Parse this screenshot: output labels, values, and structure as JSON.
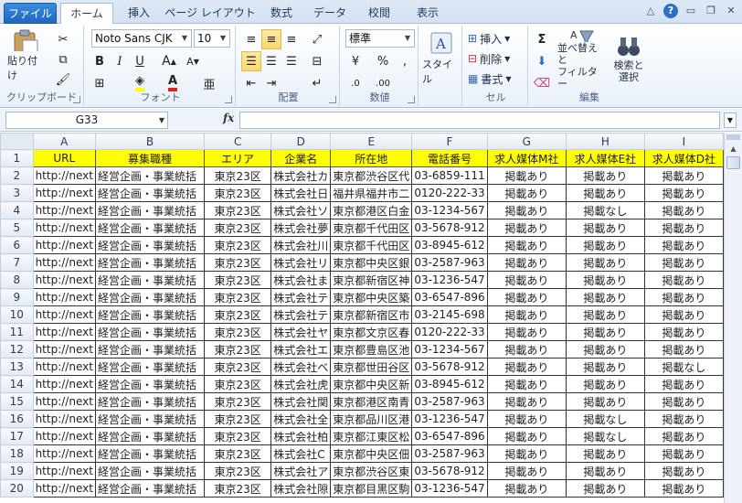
{
  "tabs": [
    "ファイル",
    "ホーム",
    "挿入",
    "ページ レイアウト",
    "数式",
    "データ",
    "校閲",
    "表示"
  ],
  "ribbon": {
    "clipboard": {
      "paste": "貼り付け",
      "label": "クリップボード"
    },
    "font": {
      "name": "Noto Sans CJK",
      "size": "10",
      "bold": "B",
      "italic": "I",
      "underline": "U",
      "label": "フォント"
    },
    "alignment": {
      "label": "配置"
    },
    "number": {
      "format": "標準",
      "label": "数値"
    },
    "styles": {
      "button": "スタイル"
    },
    "cells": {
      "insert": "挿入",
      "delete": "削除",
      "format": "書式",
      "label": "セル"
    },
    "editing": {
      "sum": "Σ",
      "sort": "並べ替えと\nフィルター",
      "sort_line1": "並べ替えと",
      "sort_line2": "フィルター",
      "find_line1": "検索と",
      "find_line2": "選択",
      "label": "編集"
    }
  },
  "formula_bar": {
    "name_box": "G33",
    "fx": "fx",
    "value": ""
  },
  "columns": [
    "A",
    "B",
    "C",
    "D",
    "E",
    "F",
    "G",
    "H",
    "I"
  ],
  "header_row": [
    "URL",
    "募集職種",
    "エリア",
    "企業名",
    "所在地",
    "電話番号",
    "求人媒体M社",
    "求人媒体E社",
    "求人媒体D社"
  ],
  "rows": [
    [
      "http://next",
      "経営企画・事業統括",
      "東京23区",
      "株式会社カ",
      "東京都渋谷区代",
      "03-6859-111",
      "掲載あり",
      "掲載あり",
      "掲載あり"
    ],
    [
      "http://next",
      "経営企画・事業統括",
      "東京23区",
      "株式会社日",
      "福井県福井市二",
      "0120-222-33",
      "掲載あり",
      "掲載あり",
      "掲載あり"
    ],
    [
      "http://next",
      "経営企画・事業統括",
      "東京23区",
      "株式会社ソ",
      "東京都港区白金",
      "03-1234-567",
      "掲載あり",
      "掲載なし",
      "掲載あり"
    ],
    [
      "http://next",
      "経営企画・事業統括",
      "東京23区",
      "株式会社夢",
      "東京都千代田区",
      "03-5678-912",
      "掲載あり",
      "掲載あり",
      "掲載あり"
    ],
    [
      "http://next",
      "経営企画・事業統括",
      "東京23区",
      "株式会社川",
      "東京都千代田区",
      "03-8945-612",
      "掲載あり",
      "掲載あり",
      "掲載あり"
    ],
    [
      "http://next",
      "経営企画・事業統括",
      "東京23区",
      "株式会社リ",
      "東京都中央区銀",
      "03-2587-963",
      "掲載あり",
      "掲載あり",
      "掲載あり"
    ],
    [
      "http://next",
      "経営企画・事業統括",
      "東京23区",
      "株式会社ま",
      "東京都新宿区神",
      "03-1236-547",
      "掲載あり",
      "掲載あり",
      "掲載あり"
    ],
    [
      "http://next",
      "経営企画・事業統括",
      "東京23区",
      "株式会社テ",
      "東京都中央区築",
      "03-6547-896",
      "掲載あり",
      "掲載あり",
      "掲載あり"
    ],
    [
      "http://next",
      "経営企画・事業統括",
      "東京23区",
      "株式会社テ",
      "東京都新宿区市",
      "03-2145-698",
      "掲載あり",
      "掲載あり",
      "掲載あり"
    ],
    [
      "http://next",
      "経営企画・事業統括",
      "東京23区",
      "株式会社ヤ",
      "東京都文京区春",
      "0120-222-33",
      "掲載あり",
      "掲載あり",
      "掲載あり"
    ],
    [
      "http://next",
      "経営企画・事業統括",
      "東京23区",
      "株式会社エ",
      "東京都豊島区池",
      "03-1234-567",
      "掲載あり",
      "掲載あり",
      "掲載あり"
    ],
    [
      "http://next",
      "経営企画・事業統括",
      "東京23区",
      "株式会社ベ",
      "東京都世田谷区",
      "03-5678-912",
      "掲載あり",
      "掲載あり",
      "掲載なし"
    ],
    [
      "http://next",
      "経営企画・事業統括",
      "東京23区",
      "株式会社虎",
      "東京都中央区新",
      "03-8945-612",
      "掲載あり",
      "掲載あり",
      "掲載あり"
    ],
    [
      "http://next",
      "経営企画・事業統括",
      "東京23区",
      "株式会社関",
      "東京都港区南青",
      "03-2587-963",
      "掲載あり",
      "掲載あり",
      "掲載あり"
    ],
    [
      "http://next",
      "経営企画・事業統括",
      "東京23区",
      "株式会社全",
      "東京都品川区港",
      "03-1236-547",
      "掲載あり",
      "掲載なし",
      "掲載あり"
    ],
    [
      "http://next",
      "経営企画・事業統括",
      "東京23区",
      "株式会社柏",
      "東京都江東区松",
      "03-6547-896",
      "掲載あり",
      "掲載なし",
      "掲載あり"
    ],
    [
      "http://next",
      "経営企画・事業統括",
      "東京23区",
      "株式会社C",
      "東京都中央区佃",
      "03-2587-963",
      "掲載あり",
      "掲載あり",
      "掲載あり"
    ],
    [
      "http://next",
      "経営企画・事業統括",
      "東京23区",
      "株式会社ア",
      "東京都渋谷区東",
      "03-5678-912",
      "掲載あり",
      "掲載あり",
      "掲載あり"
    ],
    [
      "http://next",
      "経営企画・事業統括",
      "東京23区",
      "株式会社隙",
      "東京都目黒区駒",
      "03-1236-547",
      "掲載あり",
      "掲載あり",
      "掲載あり"
    ]
  ],
  "colors": {
    "header_fill": "#ffff00",
    "file_tab": "#2a76cf"
  }
}
